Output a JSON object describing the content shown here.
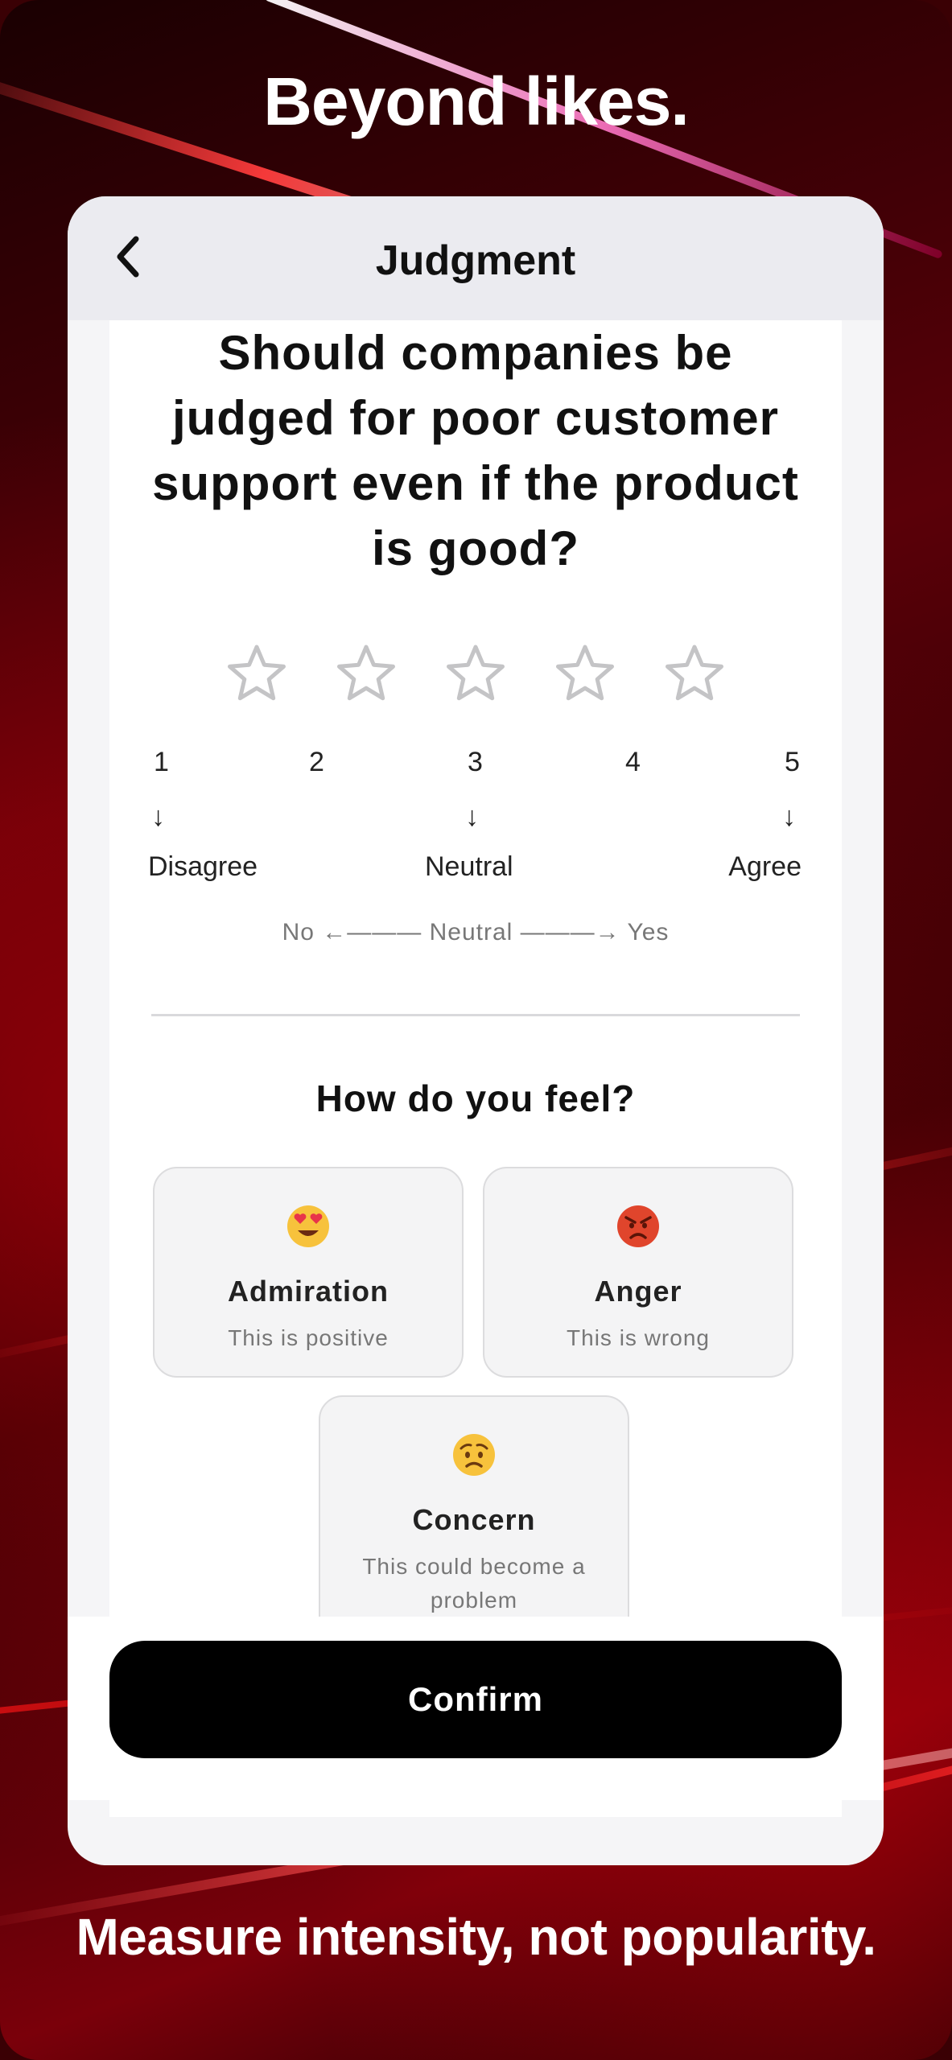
{
  "promo": {
    "headline": "Beyond likes.",
    "footline": "Measure intensity, not popularity."
  },
  "nav": {
    "back_icon": "chevron-left-icon",
    "title": "Judgment"
  },
  "question": "Should companies be judged for poor customer support even if the product is good?",
  "rating": {
    "max_stars": 5,
    "selected": 0,
    "scale_numbers": [
      "1",
      "2",
      "3",
      "4",
      "5"
    ],
    "arrow": "↓",
    "labels": {
      "low": "Disagree",
      "mid": "Neutral",
      "high": "Agree"
    },
    "hint": "No ←——— Neutral ———→ Yes"
  },
  "feelings": {
    "title": "How do you feel?",
    "options": [
      {
        "emoji": "😍",
        "icon": "heart-eyes-emoji-icon",
        "name": "Admiration",
        "desc": "This is positive"
      },
      {
        "emoji": "😡",
        "icon": "angry-face-emoji-icon",
        "name": "Anger",
        "desc": "This is wrong"
      },
      {
        "emoji": "😟",
        "icon": "worried-face-emoji-icon",
        "name": "Concern",
        "desc": "This could become a problem"
      }
    ]
  },
  "confirm_label": "Confirm",
  "colors": {
    "accent": "#000000",
    "background_red": "#c8000a",
    "card_bg": "#f4f4f5"
  }
}
